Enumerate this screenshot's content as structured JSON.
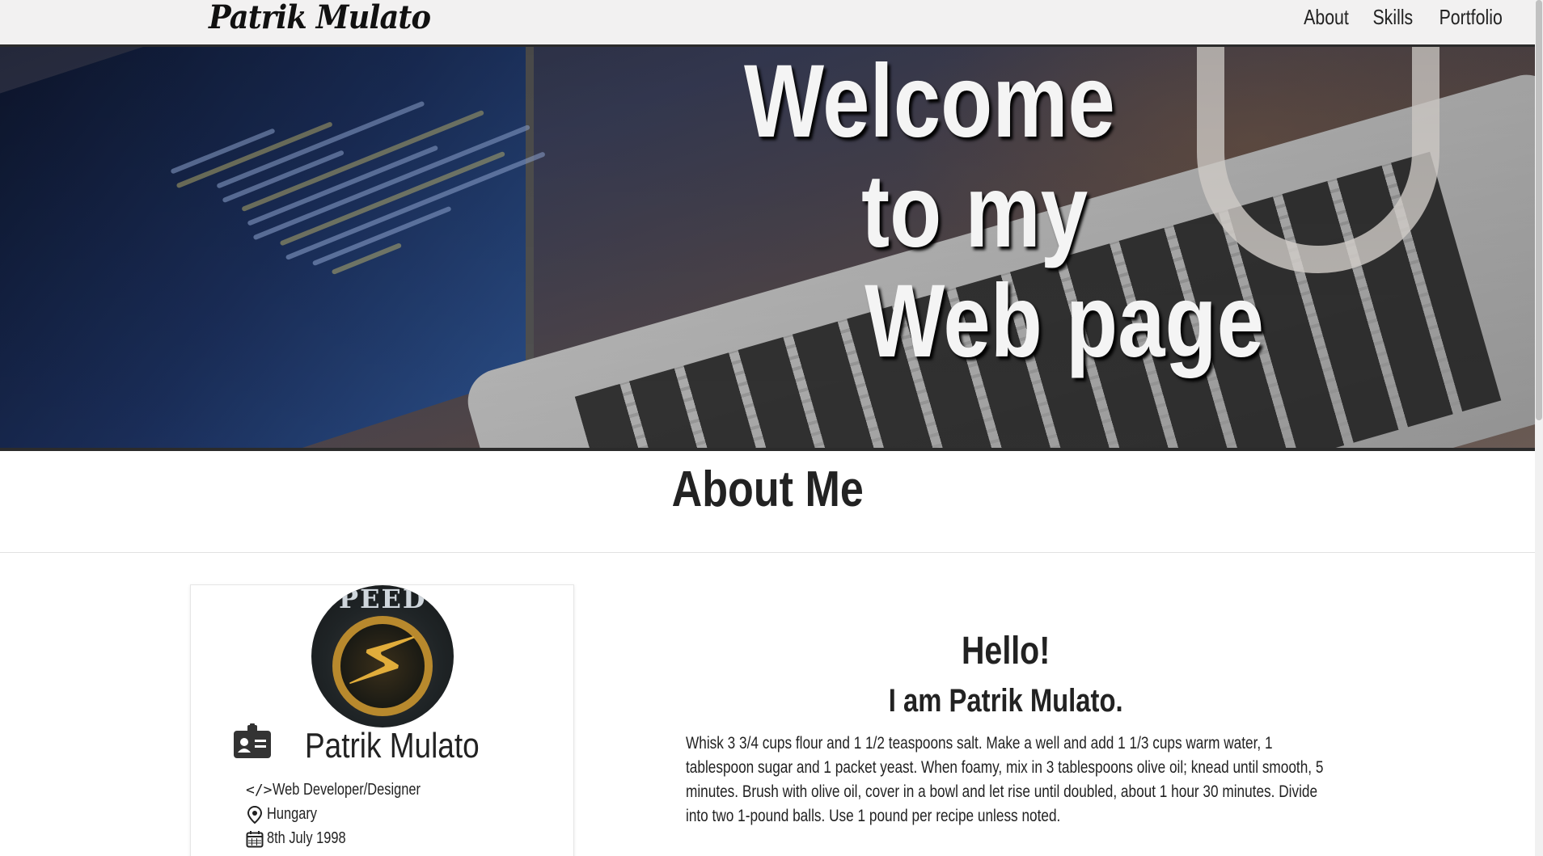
{
  "navbar": {
    "brand": "Patrik Mulato",
    "links": [
      "About",
      "Skills",
      "Portfolio"
    ]
  },
  "hero": {
    "title_lines": [
      "Welcome",
      "to my",
      "Web page"
    ]
  },
  "about": {
    "heading": "About Me",
    "card": {
      "avatar_text": "PEED",
      "name": "Patrik Mulato",
      "role_icon_text": "</>",
      "role": "Web Developer/Designer",
      "location": "Hungary",
      "birthdate": "8th July 1998"
    },
    "intro": {
      "greeting": "Hello!",
      "subtitle": "I am Patrik Mulato.",
      "bio": "Whisk 3 3/4 cups flour and 1 1/2 teaspoons salt. Make a well and add 1 1/3 cups warm water, 1 tablespoon sugar and 1 packet yeast. When foamy, mix in 3 tablespoons olive oil; knead until smooth, 5 minutes. Brush with olive oil, cover in a bowl and let rise until doubled, about 1 hour 30 minutes. Divide into two 1-pound balls. Use 1 pound per recipe unless noted."
    }
  },
  "icons": {
    "id_card": "id-card-icon",
    "code": "code-icon",
    "location": "map-pin-icon",
    "calendar": "calendar-icon",
    "avatar_emblem": "lightning-bolt-icon"
  },
  "colors": {
    "navbar_bg": "#f2f1f1",
    "text": "#222222",
    "hero_text": "#f4f4f4",
    "avatar_gold": "#b8892d"
  }
}
